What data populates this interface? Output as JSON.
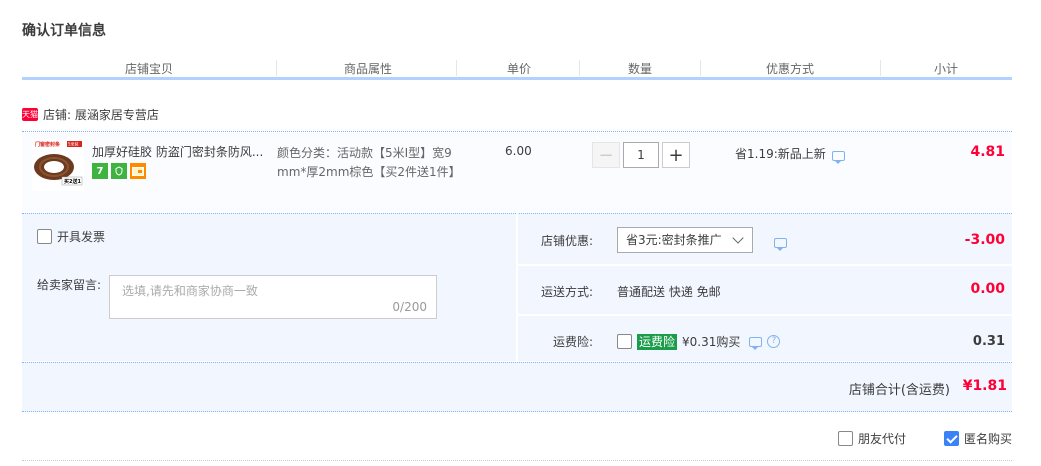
{
  "section_title": "确认订单信息",
  "columns": [
    "店铺宝贝",
    "商品属性",
    "单价",
    "数量",
    "优惠方式",
    "小计"
  ],
  "shop": {
    "badge": "天猫",
    "name": "店铺: 展涵家居专营店"
  },
  "item": {
    "thumb_text_top": "门窗密封条",
    "thumb_tag": "买2送1",
    "thumb_badge": "5米装",
    "name": "加厚好硅胶 防盗门密封条防风...",
    "badge_seven": "7",
    "attributes": "颜色分类：活动款【5米I型】宽9mm*厚2mm棕色【买2件送1件】",
    "unit_price": "6.00",
    "quantity": "1",
    "promotion": "省1.19:新品上新",
    "subtotal": "4.81"
  },
  "invoice_label": "开具发票",
  "message": {
    "label": "给卖家留言:",
    "placeholder": "选填,请先和商家协商一致",
    "counter": "0/200"
  },
  "shop_discount": {
    "label": "店铺优惠:",
    "selected": "省3元:密封条推广",
    "value": "-3.00"
  },
  "shipping": {
    "label": "运送方式:",
    "method": "普通配送 快递 免邮",
    "value": "0.00"
  },
  "insurance": {
    "label": "运费险:",
    "tag": "运费险",
    "text": "¥0.31购买",
    "value": "0.31"
  },
  "total": {
    "label": "店铺合计(含运费)",
    "value": "¥1.81"
  },
  "options": {
    "friend_pay": "朋友代付",
    "anonymous": "匿名购买"
  },
  "colors": {
    "accent_red": "#ff0036",
    "header_line": "#b2d1ff",
    "panel_bg": "#f2f7ff",
    "checkbox_on": "#3b82f6"
  }
}
